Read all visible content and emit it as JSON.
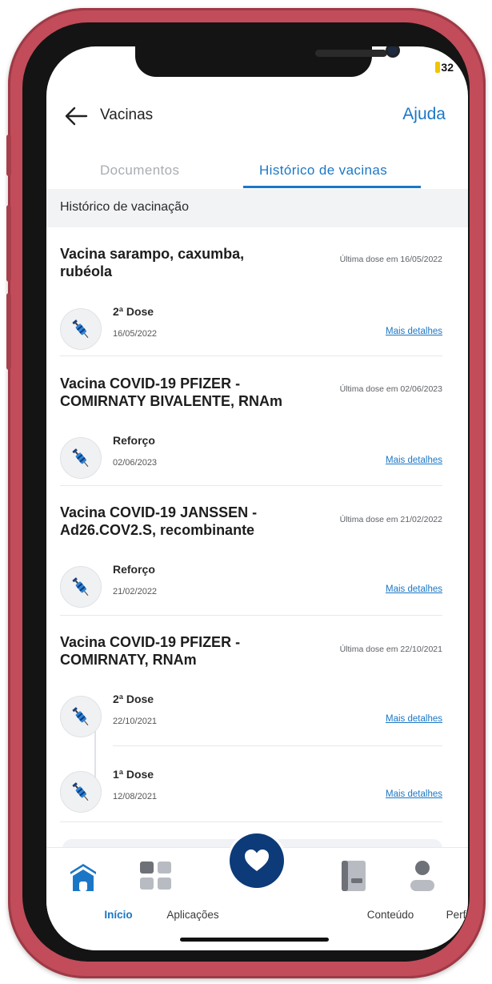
{
  "status": {
    "time": "32"
  },
  "header": {
    "title": "Vacinas",
    "help": "Ajuda"
  },
  "tabs": [
    {
      "label": "Documentos"
    },
    {
      "label": "Histórico de vacinas"
    }
  ],
  "section": {
    "title": "Histórico de vacinação"
  },
  "vaccines": [
    {
      "name": "Vacina sarampo, caxumba, rubéola",
      "last_dose": "Última dose em 16/05/2022",
      "doses": [
        {
          "label": "2ª Dose",
          "date": "16/05/2022",
          "link": "Mais detalhes"
        }
      ]
    },
    {
      "name": "Vacina COVID-19 PFIZER - COMIRNATY BIVALENTE, RNAm",
      "last_dose": "Última dose em 02/06/2023",
      "doses": [
        {
          "label": "Reforço",
          "date": "02/06/2023",
          "link": "Mais detalhes"
        }
      ]
    },
    {
      "name": "Vacina COVID-19 JANSSEN - Ad26.COV2.S, recombinante",
      "last_dose": "Última dose em 21/02/2022",
      "doses": [
        {
          "label": "Reforço",
          "date": "21/02/2022",
          "link": "Mais detalhes"
        }
      ]
    },
    {
      "name": "Vacina COVID-19 PFIZER - COMIRNATY, RNAm",
      "last_dose": "Última dose em 22/10/2021",
      "doses": [
        {
          "label": "2ª Dose",
          "date": "22/10/2021",
          "link": "Mais detalhes"
        },
        {
          "label": "1ª Dose",
          "date": "12/08/2021",
          "link": "Mais detalhes"
        }
      ]
    }
  ],
  "nav": [
    {
      "label": "Início",
      "icon": "home-icon"
    },
    {
      "label": "Aplicações",
      "icon": "apps-grid-icon"
    },
    {
      "label": "",
      "icon": "heart-icon"
    },
    {
      "label": "Conteúdo",
      "icon": "book-icon"
    },
    {
      "label": "Perfil",
      "icon": "profile-icon"
    }
  ],
  "colors": {
    "accent": "#1b77c6",
    "fab": "#0d3a78",
    "frame": "#c24c5a"
  }
}
